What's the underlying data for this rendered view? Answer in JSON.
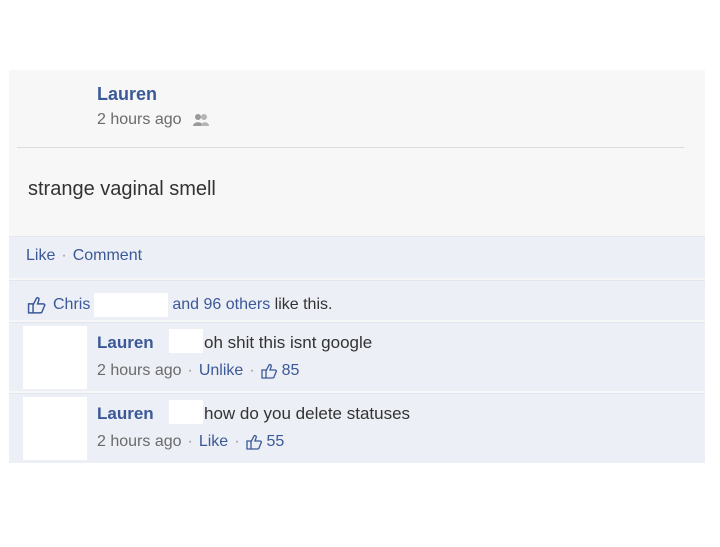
{
  "post": {
    "author": "Lauren",
    "time": "2 hours ago",
    "privacy_icon": "friends-icon",
    "status": "strange vaginal smell",
    "actions": {
      "like": "Like",
      "comment": "Comment"
    },
    "likes": {
      "first": "Chris",
      "others": "and 96 others",
      "suffix": "like this."
    }
  },
  "comments": [
    {
      "author": "Lauren",
      "text": "oh shit this isnt google",
      "time": "2 hours ago",
      "action": "Unlike",
      "likes": "85"
    },
    {
      "author": "Lauren",
      "text": "how do you delete statuses",
      "time": "2 hours ago",
      "action": "Like",
      "likes": "55"
    }
  ],
  "colors": {
    "link": "#3b5998",
    "panel": "#eceff5",
    "meta": "#6b6b6b"
  }
}
